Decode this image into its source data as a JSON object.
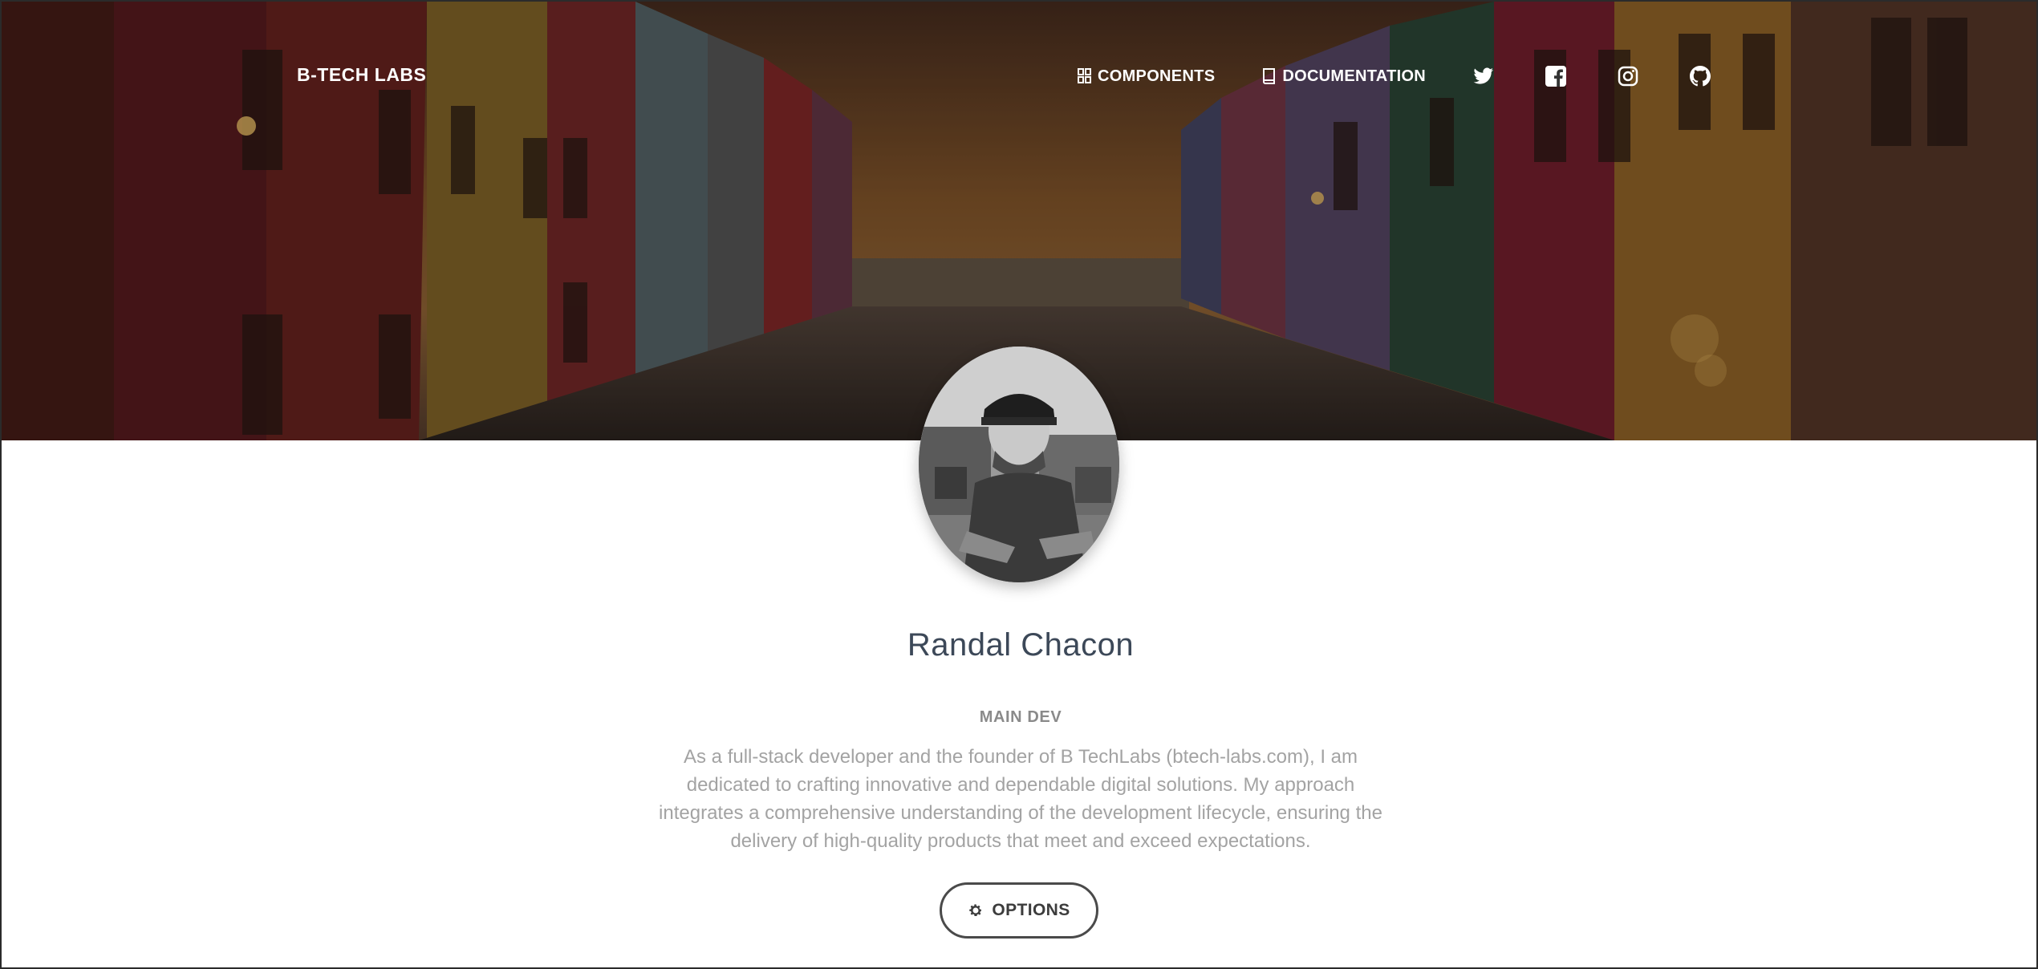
{
  "nav": {
    "brand": "B-TECH LABS",
    "links": [
      {
        "label": "COMPONENTS",
        "icon": "grid-icon"
      },
      {
        "label": "DOCUMENTATION",
        "icon": "book-icon"
      }
    ],
    "social": [
      "twitter-icon",
      "facebook-icon",
      "instagram-icon",
      "github-icon"
    ]
  },
  "profile": {
    "name": "Randal Chacon",
    "role": "MAIN DEV",
    "bio": "As a full-stack developer and the founder of B TechLabs (btech-labs.com), I am dedicated to crafting innovative and dependable digital solutions. My approach integrates a comprehensive understanding of the development lifecycle, ensuring the delivery of high-quality products that meet and exceed expectations.",
    "options_label": "OPTIONS",
    "options_icon": "gear-icon"
  },
  "colors": {
    "title": "#3c4858",
    "muted": "#8a8a8a",
    "bio": "#a3a3a3",
    "button_border": "#4a4a4a"
  }
}
